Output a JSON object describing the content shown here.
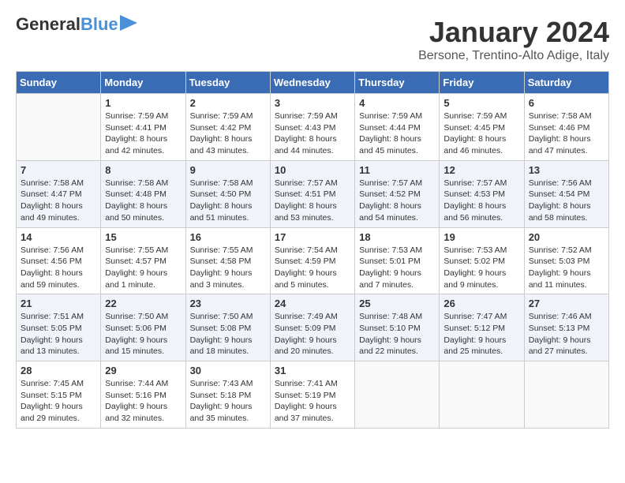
{
  "header": {
    "logo_line1": "General",
    "logo_line2": "Blue",
    "title": "January 2024",
    "subtitle": "Bersone, Trentino-Alto Adige, Italy"
  },
  "days_of_week": [
    "Sunday",
    "Monday",
    "Tuesday",
    "Wednesday",
    "Thursday",
    "Friday",
    "Saturday"
  ],
  "weeks": [
    [
      {
        "day": "",
        "sunrise": "",
        "sunset": "",
        "daylight": ""
      },
      {
        "day": "1",
        "sunrise": "Sunrise: 7:59 AM",
        "sunset": "Sunset: 4:41 PM",
        "daylight": "Daylight: 8 hours and 42 minutes."
      },
      {
        "day": "2",
        "sunrise": "Sunrise: 7:59 AM",
        "sunset": "Sunset: 4:42 PM",
        "daylight": "Daylight: 8 hours and 43 minutes."
      },
      {
        "day": "3",
        "sunrise": "Sunrise: 7:59 AM",
        "sunset": "Sunset: 4:43 PM",
        "daylight": "Daylight: 8 hours and 44 minutes."
      },
      {
        "day": "4",
        "sunrise": "Sunrise: 7:59 AM",
        "sunset": "Sunset: 4:44 PM",
        "daylight": "Daylight: 8 hours and 45 minutes."
      },
      {
        "day": "5",
        "sunrise": "Sunrise: 7:59 AM",
        "sunset": "Sunset: 4:45 PM",
        "daylight": "Daylight: 8 hours and 46 minutes."
      },
      {
        "day": "6",
        "sunrise": "Sunrise: 7:58 AM",
        "sunset": "Sunset: 4:46 PM",
        "daylight": "Daylight: 8 hours and 47 minutes."
      }
    ],
    [
      {
        "day": "7",
        "sunrise": "Sunrise: 7:58 AM",
        "sunset": "Sunset: 4:47 PM",
        "daylight": "Daylight: 8 hours and 49 minutes."
      },
      {
        "day": "8",
        "sunrise": "Sunrise: 7:58 AM",
        "sunset": "Sunset: 4:48 PM",
        "daylight": "Daylight: 8 hours and 50 minutes."
      },
      {
        "day": "9",
        "sunrise": "Sunrise: 7:58 AM",
        "sunset": "Sunset: 4:50 PM",
        "daylight": "Daylight: 8 hours and 51 minutes."
      },
      {
        "day": "10",
        "sunrise": "Sunrise: 7:57 AM",
        "sunset": "Sunset: 4:51 PM",
        "daylight": "Daylight: 8 hours and 53 minutes."
      },
      {
        "day": "11",
        "sunrise": "Sunrise: 7:57 AM",
        "sunset": "Sunset: 4:52 PM",
        "daylight": "Daylight: 8 hours and 54 minutes."
      },
      {
        "day": "12",
        "sunrise": "Sunrise: 7:57 AM",
        "sunset": "Sunset: 4:53 PM",
        "daylight": "Daylight: 8 hours and 56 minutes."
      },
      {
        "day": "13",
        "sunrise": "Sunrise: 7:56 AM",
        "sunset": "Sunset: 4:54 PM",
        "daylight": "Daylight: 8 hours and 58 minutes."
      }
    ],
    [
      {
        "day": "14",
        "sunrise": "Sunrise: 7:56 AM",
        "sunset": "Sunset: 4:56 PM",
        "daylight": "Daylight: 8 hours and 59 minutes."
      },
      {
        "day": "15",
        "sunrise": "Sunrise: 7:55 AM",
        "sunset": "Sunset: 4:57 PM",
        "daylight": "Daylight: 9 hours and 1 minute."
      },
      {
        "day": "16",
        "sunrise": "Sunrise: 7:55 AM",
        "sunset": "Sunset: 4:58 PM",
        "daylight": "Daylight: 9 hours and 3 minutes."
      },
      {
        "day": "17",
        "sunrise": "Sunrise: 7:54 AM",
        "sunset": "Sunset: 4:59 PM",
        "daylight": "Daylight: 9 hours and 5 minutes."
      },
      {
        "day": "18",
        "sunrise": "Sunrise: 7:53 AM",
        "sunset": "Sunset: 5:01 PM",
        "daylight": "Daylight: 9 hours and 7 minutes."
      },
      {
        "day": "19",
        "sunrise": "Sunrise: 7:53 AM",
        "sunset": "Sunset: 5:02 PM",
        "daylight": "Daylight: 9 hours and 9 minutes."
      },
      {
        "day": "20",
        "sunrise": "Sunrise: 7:52 AM",
        "sunset": "Sunset: 5:03 PM",
        "daylight": "Daylight: 9 hours and 11 minutes."
      }
    ],
    [
      {
        "day": "21",
        "sunrise": "Sunrise: 7:51 AM",
        "sunset": "Sunset: 5:05 PM",
        "daylight": "Daylight: 9 hours and 13 minutes."
      },
      {
        "day": "22",
        "sunrise": "Sunrise: 7:50 AM",
        "sunset": "Sunset: 5:06 PM",
        "daylight": "Daylight: 9 hours and 15 minutes."
      },
      {
        "day": "23",
        "sunrise": "Sunrise: 7:50 AM",
        "sunset": "Sunset: 5:08 PM",
        "daylight": "Daylight: 9 hours and 18 minutes."
      },
      {
        "day": "24",
        "sunrise": "Sunrise: 7:49 AM",
        "sunset": "Sunset: 5:09 PM",
        "daylight": "Daylight: 9 hours and 20 minutes."
      },
      {
        "day": "25",
        "sunrise": "Sunrise: 7:48 AM",
        "sunset": "Sunset: 5:10 PM",
        "daylight": "Daylight: 9 hours and 22 minutes."
      },
      {
        "day": "26",
        "sunrise": "Sunrise: 7:47 AM",
        "sunset": "Sunset: 5:12 PM",
        "daylight": "Daylight: 9 hours and 25 minutes."
      },
      {
        "day": "27",
        "sunrise": "Sunrise: 7:46 AM",
        "sunset": "Sunset: 5:13 PM",
        "daylight": "Daylight: 9 hours and 27 minutes."
      }
    ],
    [
      {
        "day": "28",
        "sunrise": "Sunrise: 7:45 AM",
        "sunset": "Sunset: 5:15 PM",
        "daylight": "Daylight: 9 hours and 29 minutes."
      },
      {
        "day": "29",
        "sunrise": "Sunrise: 7:44 AM",
        "sunset": "Sunset: 5:16 PM",
        "daylight": "Daylight: 9 hours and 32 minutes."
      },
      {
        "day": "30",
        "sunrise": "Sunrise: 7:43 AM",
        "sunset": "Sunset: 5:18 PM",
        "daylight": "Daylight: 9 hours and 35 minutes."
      },
      {
        "day": "31",
        "sunrise": "Sunrise: 7:41 AM",
        "sunset": "Sunset: 5:19 PM",
        "daylight": "Daylight: 9 hours and 37 minutes."
      },
      {
        "day": "",
        "sunrise": "",
        "sunset": "",
        "daylight": ""
      },
      {
        "day": "",
        "sunrise": "",
        "sunset": "",
        "daylight": ""
      },
      {
        "day": "",
        "sunrise": "",
        "sunset": "",
        "daylight": ""
      }
    ]
  ]
}
